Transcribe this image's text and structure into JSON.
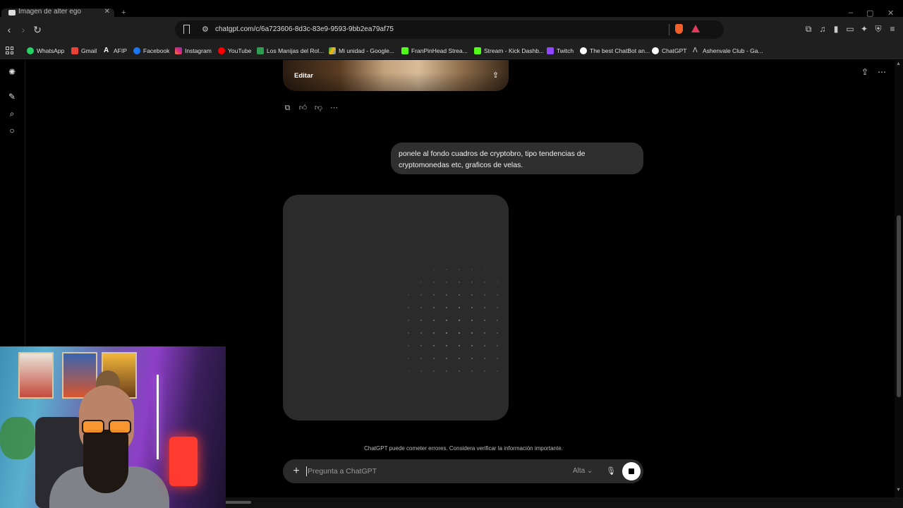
{
  "browser": {
    "tab_title": "Imagen de alter ego",
    "url": "chatgpt.com/c/6a723606-8d3c-83e9-9593-9bb2ea79af75",
    "bookmarks": [
      {
        "label": "WhatsApp",
        "color": "#25d366"
      },
      {
        "label": "Gmail",
        "color": "#ea4335"
      },
      {
        "label": "AFIP",
        "color": "#ffffff"
      },
      {
        "label": "Facebook",
        "color": "#1877f2"
      },
      {
        "label": "Instagram",
        "color": "#e1306c"
      },
      {
        "label": "YouTube",
        "color": "#ff0000"
      },
      {
        "label": "Los Manijas del Rol...",
        "color": "#2e9d4f"
      },
      {
        "label": "Mi unidad - Google...",
        "color": "#fbbc04"
      },
      {
        "label": "FranPinHead Strea...",
        "color": "#53fc18"
      },
      {
        "label": "Stream - Kick Dashb...",
        "color": "#53fc18"
      },
      {
        "label": "Twitch",
        "color": "#9146ff"
      },
      {
        "label": "The best ChatBot an...",
        "color": "#ffffff"
      },
      {
        "label": "ChatGPT",
        "color": "#ffffff"
      },
      {
        "label": "Ashenvale Club - Ga...",
        "color": "#cfd8dc"
      }
    ]
  },
  "chat": {
    "edit_label": "Editar",
    "user_message": "ponele al fondo cuadros de cryptobro, tipo tendencias de cryptomonedas etc, graficos de velas.",
    "disclaimer": "ChatGPT puede cometer errores. Considera verificar la información importante.",
    "composer": {
      "placeholder": "Pregunta a ChatGPT",
      "model": "Alta"
    }
  },
  "icons": {
    "sidebar": [
      "openai-logo-icon",
      "new-chat-icon",
      "search-icon",
      "chat-bubble-icon"
    ],
    "actions": [
      "copy-icon",
      "thumbs-up-icon",
      "thumbs-down-icon",
      "more-icon"
    ]
  }
}
